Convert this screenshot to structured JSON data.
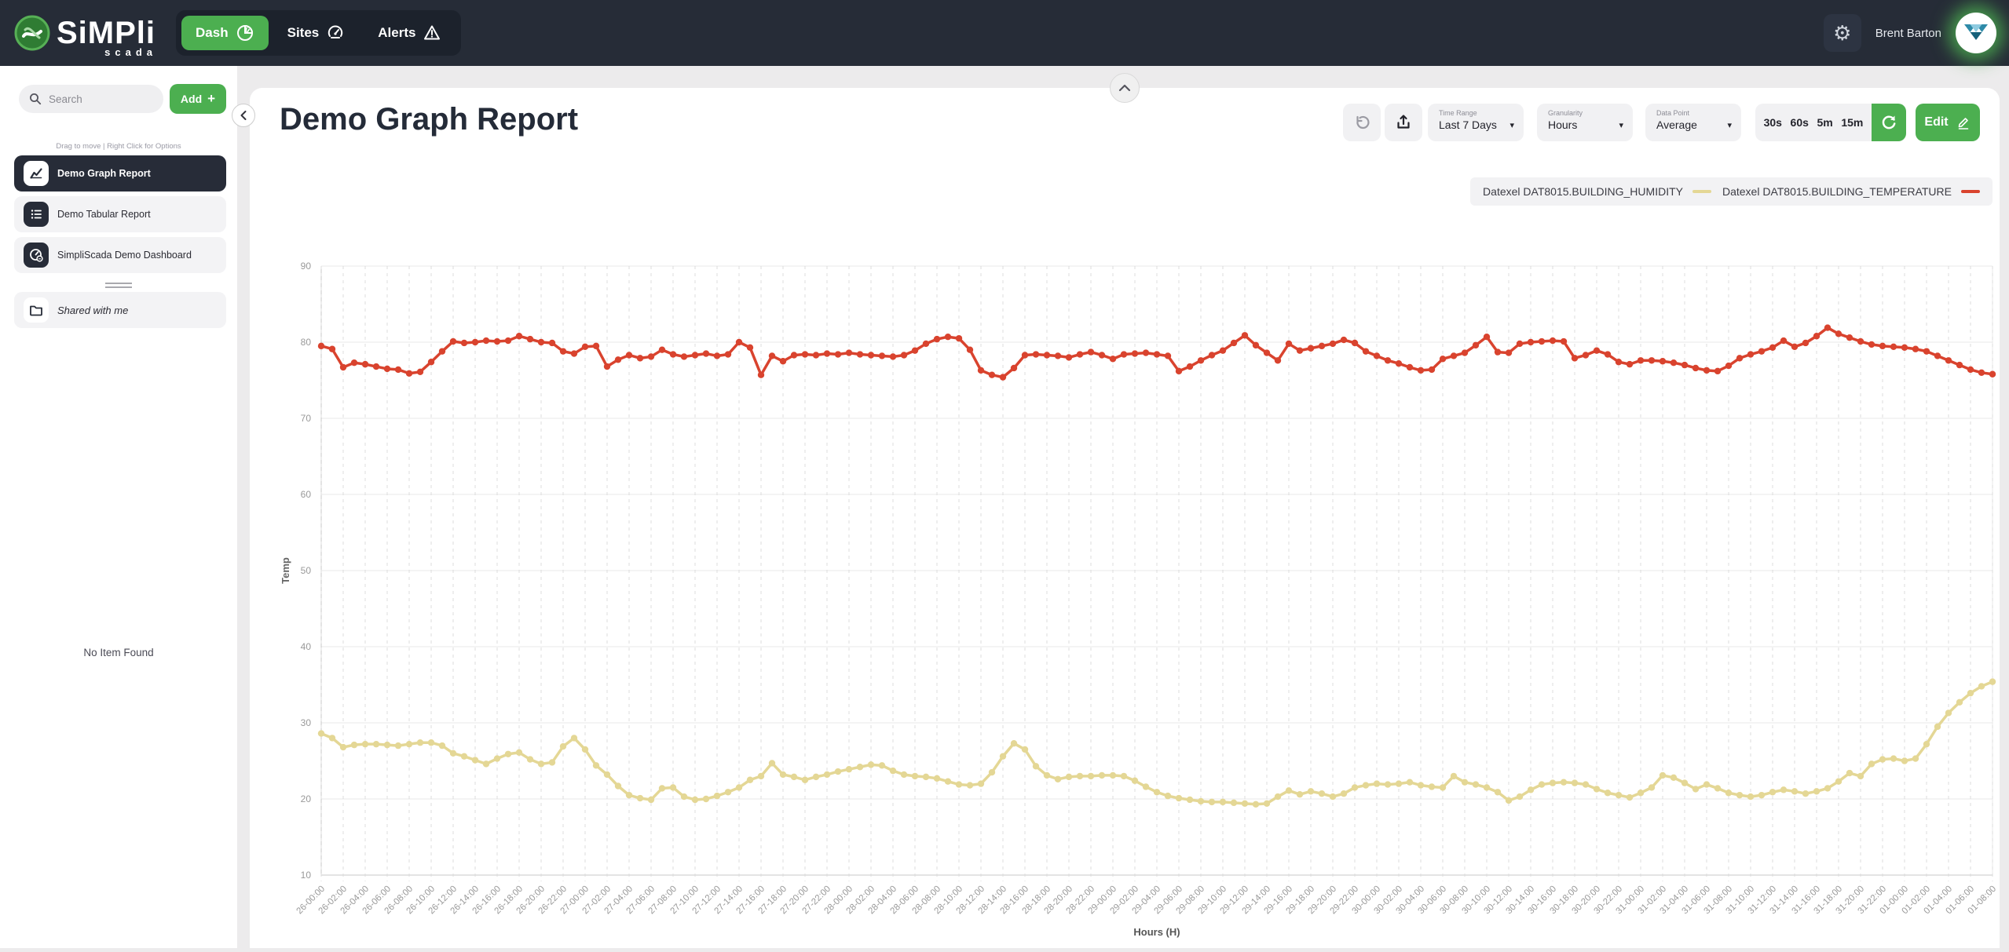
{
  "navbar": {
    "brand": {
      "name": "SiMPli",
      "sub": "scada",
      "icon": "simpliscada-logo-icon"
    },
    "tabs": [
      {
        "label": "Dash",
        "icon": "pie-chart-icon",
        "active": true
      },
      {
        "label": "Sites",
        "icon": "gauge-icon",
        "active": false
      },
      {
        "label": "Alerts",
        "icon": "warning-triangle-icon",
        "active": false
      }
    ],
    "settings_icon": "gear-icon",
    "gear_glyph": "⚙",
    "user": {
      "name": "Brent Barton",
      "avatar_icon": "user-avatar-logo"
    }
  },
  "sidebar": {
    "search_placeholder": "Search",
    "add_label": "Add",
    "add_plus": "+",
    "hint": "Drag to move | Right Click for Options",
    "items": [
      {
        "label": "Demo Graph Report",
        "icon": "line-chart-icon",
        "active": true
      },
      {
        "label": "Demo Tabular Report",
        "icon": "table-list-icon",
        "active": false
      },
      {
        "label": "SimpliScada Demo Dashboard",
        "icon": "dashboard-gauge-icon",
        "active": false
      }
    ],
    "shared_label": "Shared with me",
    "shared_icon": "folder-icon",
    "empty_text": "No Item Found"
  },
  "report": {
    "title": "Demo Graph Report",
    "controls": {
      "undo_icon": "undo-icon",
      "export_icon": "export-icon",
      "time_range": {
        "label": "Time Range",
        "value": "Last 7 Days"
      },
      "granularity": {
        "label": "Granularity",
        "value": "Hours"
      },
      "data_point": {
        "label": "Data Point",
        "value": "Average"
      },
      "caret": "▾",
      "quick_ranges": [
        "30s",
        "60s",
        "5m",
        "15m"
      ],
      "refresh_icon": "refresh-icon",
      "edit_label": "Edit",
      "edit_icon": "pencil-icon"
    }
  },
  "colors": {
    "accent_green": "#4caf50",
    "navbar_bg": "#262c37",
    "humidity_line": "#e4d795",
    "temperature_line": "#d9432e"
  },
  "chart_data": {
    "type": "line",
    "title": "",
    "xlabel": "Hours (H)",
    "ylabel": "Temp",
    "ylim": [
      10,
      90
    ],
    "y_ticks": [
      90,
      80,
      70,
      60,
      50,
      40,
      30,
      20,
      10
    ],
    "grid": true,
    "legend_position": "top-right",
    "x_step_hours": 1,
    "points_per_label": 2,
    "x_tick_labels": [
      "26-00:00",
      "26-02:00",
      "26-04:00",
      "26-06:00",
      "26-08:00",
      "26-10:00",
      "26-12:00",
      "26-14:00",
      "26-16:00",
      "26-18:00",
      "26-20:00",
      "26-22:00",
      "27-00:00",
      "27-02:00",
      "27-04:00",
      "27-06:00",
      "27-08:00",
      "27-10:00",
      "27-12:00",
      "27-14:00",
      "27-16:00",
      "27-18:00",
      "27-20:00",
      "27-22:00",
      "28-00:00",
      "28-02:00",
      "28-04:00",
      "28-06:00",
      "28-08:00",
      "28-10:00",
      "28-12:00",
      "28-14:00",
      "28-16:00",
      "28-18:00",
      "28-20:00",
      "28-22:00",
      "29-00:00",
      "29-02:00",
      "29-04:00",
      "29-06:00",
      "29-08:00",
      "29-10:00",
      "29-12:00",
      "29-14:00",
      "29-16:00",
      "29-18:00",
      "29-20:00",
      "29-22:00",
      "30-00:00",
      "30-02:00",
      "30-04:00",
      "30-06:00",
      "30-08:00",
      "30-10:00",
      "30-12:00",
      "30-14:00",
      "30-16:00",
      "30-18:00",
      "30-20:00",
      "30-22:00",
      "31-00:00",
      "31-02:00",
      "31-04:00",
      "31-06:00",
      "31-08:00",
      "31-10:00",
      "31-12:00",
      "31-14:00",
      "31-16:00",
      "31-18:00",
      "31-20:00",
      "31-22:00",
      "01-00:00",
      "01-02:00",
      "01-04:00",
      "01-06:00",
      "01-08:00"
    ],
    "series": [
      {
        "name": "Datexel DAT8015.BUILDING_HUMIDITY",
        "color": "#e4d795",
        "values": [
          28.6,
          28.0,
          26.8,
          27.1,
          27.2,
          27.2,
          27.1,
          27.0,
          27.2,
          27.4,
          27.4,
          27.0,
          26.0,
          25.6,
          25.1,
          24.6,
          25.3,
          25.9,
          26.1,
          25.2,
          24.6,
          24.8,
          26.9,
          28.0,
          26.5,
          24.4,
          23.2,
          21.7,
          20.5,
          20.1,
          19.9,
          21.4,
          21.5,
          20.3,
          19.9,
          20.0,
          20.4,
          20.9,
          21.5,
          22.5,
          23.0,
          24.7,
          23.2,
          22.9,
          22.5,
          22.9,
          23.2,
          23.6,
          23.9,
          24.2,
          24.5,
          24.4,
          23.7,
          23.2,
          23.0,
          22.9,
          22.7,
          22.3,
          21.9,
          21.8,
          22.0,
          23.5,
          25.6,
          27.3,
          26.5,
          24.3,
          23.1,
          22.6,
          22.9,
          23.0,
          23.0,
          23.1,
          23.1,
          23.0,
          22.4,
          21.6,
          20.9,
          20.4,
          20.1,
          19.9,
          19.7,
          19.6,
          19.6,
          19.5,
          19.4,
          19.3,
          19.4,
          20.3,
          21.1,
          20.6,
          21.0,
          20.7,
          20.3,
          20.7,
          21.5,
          21.8,
          22.0,
          21.9,
          22.0,
          22.2,
          21.8,
          21.6,
          21.5,
          23.0,
          22.2,
          21.9,
          21.5,
          20.9,
          19.8,
          20.3,
          21.2,
          21.9,
          22.1,
          22.2,
          22.1,
          21.9,
          21.3,
          20.8,
          20.5,
          20.2,
          20.8,
          21.5,
          23.1,
          22.8,
          22.1,
          21.3,
          21.9,
          21.4,
          20.8,
          20.5,
          20.3,
          20.5,
          20.9,
          21.2,
          21.0,
          20.7,
          21.0,
          21.4,
          22.3,
          23.4,
          23.0,
          24.6,
          25.2,
          25.3,
          25.0,
          25.3,
          27.2,
          29.5,
          31.3,
          32.7,
          33.9,
          34.8,
          35.4
        ]
      },
      {
        "name": "Datexel DAT8015.BUILDING_TEMPERATURE",
        "color": "#d9432e",
        "values": [
          79.5,
          79.1,
          76.7,
          77.3,
          77.1,
          76.8,
          76.5,
          76.4,
          75.9,
          76.1,
          77.4,
          78.8,
          80.1,
          79.9,
          80.0,
          80.2,
          80.1,
          80.2,
          80.8,
          80.4,
          80.0,
          79.9,
          78.8,
          78.5,
          79.4,
          79.5,
          76.8,
          77.7,
          78.3,
          77.9,
          78.1,
          79.0,
          78.4,
          78.1,
          78.3,
          78.5,
          78.2,
          78.4,
          80.0,
          79.3,
          75.7,
          78.2,
          77.5,
          78.3,
          78.4,
          78.3,
          78.5,
          78.4,
          78.6,
          78.4,
          78.3,
          78.2,
          78.1,
          78.3,
          78.9,
          79.8,
          80.4,
          80.7,
          80.5,
          79.0,
          76.3,
          75.7,
          75.4,
          76.6,
          78.3,
          78.4,
          78.3,
          78.2,
          78.0,
          78.4,
          78.7,
          78.3,
          77.8,
          78.4,
          78.5,
          78.6,
          78.4,
          78.2,
          76.2,
          76.8,
          77.6,
          78.3,
          78.9,
          79.9,
          80.9,
          79.6,
          78.6,
          77.6,
          79.8,
          78.9,
          79.2,
          79.5,
          79.8,
          80.3,
          79.9,
          78.8,
          78.2,
          77.6,
          77.2,
          76.7,
          76.3,
          76.4,
          77.8,
          78.2,
          78.6,
          79.6,
          80.7,
          78.7,
          78.6,
          79.8,
          80.0,
          80.1,
          80.2,
          80.1,
          77.9,
          78.3,
          78.9,
          78.4,
          77.4,
          77.1,
          77.6,
          77.6,
          77.5,
          77.3,
          77.0,
          76.6,
          76.3,
          76.2,
          76.9,
          77.9,
          78.4,
          78.8,
          79.3,
          80.2,
          79.4,
          79.9,
          80.8,
          81.9,
          81.1,
          80.6,
          80.1,
          79.7,
          79.5,
          79.4,
          79.3,
          79.1,
          78.8,
          78.2,
          77.6,
          77.0,
          76.4,
          76.0,
          75.8
        ]
      }
    ]
  }
}
